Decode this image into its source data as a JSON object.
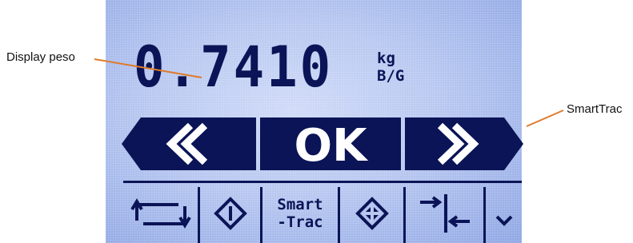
{
  "display": {
    "weight": "0.7410",
    "unit": "kg",
    "mode": "B/G"
  },
  "softkeys": {
    "left_label": "left-arrows",
    "center_label": "OK",
    "right_label": "right-arrows"
  },
  "function_keys": [
    {
      "name": "transfer-icon"
    },
    {
      "name": "start-icon"
    },
    {
      "name": "smarttrac",
      "line1": "Smart",
      "line2": "-Trac"
    },
    {
      "name": "target-icon"
    },
    {
      "name": "tare-icon"
    },
    {
      "name": "chevron-down-icon"
    }
  ],
  "callouts": {
    "display": "Display peso",
    "smarttrac": "SmartTrac"
  },
  "colors": {
    "lcd_background": "#b7c7f0",
    "segment": "#0a1456",
    "callout_line": "#e07a2a"
  }
}
